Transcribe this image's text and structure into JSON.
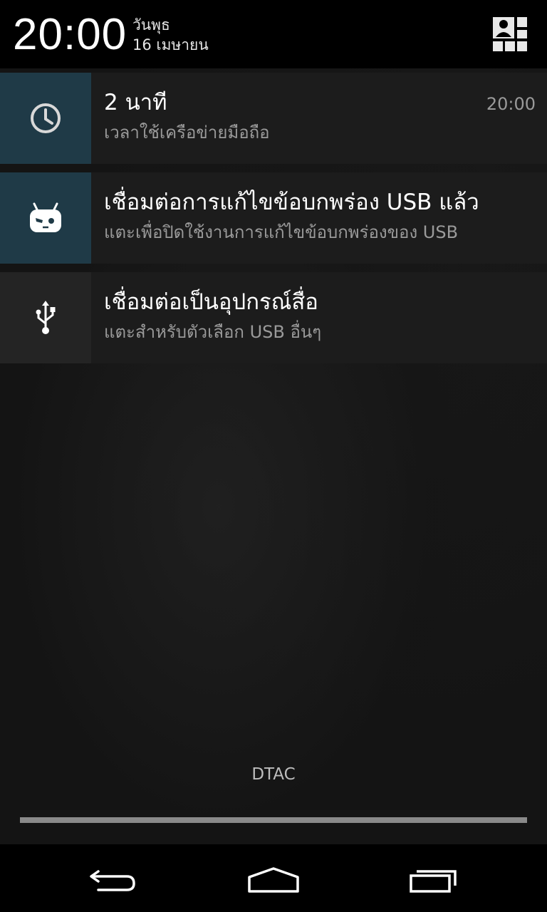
{
  "header": {
    "time": "20:00",
    "day": "วันพุธ",
    "date": "16 เมษายน"
  },
  "notifications": [
    {
      "icon": "clock-icon",
      "title": "2 นาที",
      "subtitle": "เวลาใช้เครือข่ายมือถือ",
      "time": "20:00"
    },
    {
      "icon": "cyanogenmod-icon",
      "title": "เชื่อมต่อการแก้ไขข้อบกพร่อง USB แล้ว",
      "subtitle": "แตะเพื่อปิดใช้งานการแก้ไขข้อบกพร่องของ USB"
    },
    {
      "icon": "usb-icon",
      "title": "เชื่อมต่อเป็นอุปกรณ์สื่อ",
      "subtitle": "แตะสำหรับตัวเลือก USB อื่นๆ"
    }
  ],
  "carrier": "DTAC",
  "navbar": {
    "buttons": [
      "back-icon",
      "home-icon",
      "recent-apps-icon"
    ]
  },
  "colors": {
    "accent_icon_bg": "#1f3a47",
    "notification_bg": "#1c1c1c"
  }
}
